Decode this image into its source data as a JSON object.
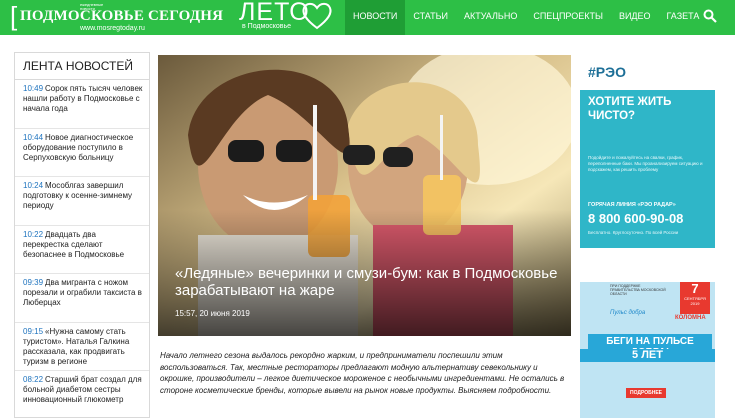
{
  "header": {
    "logo_bracket": "[",
    "logo_small": "ежедневные новости",
    "logo_title": "ПОДМОСКОВЬЕ СЕГОДНЯ",
    "logo_site": "www.mosregtoday.ru",
    "summer_big": "ЛЕТО",
    "summer_sub": "в Подмосковье",
    "nav": [
      "НОВОСТИ",
      "СТАТЬИ",
      "АКТУАЛЬНО",
      "СПЕЦПРОЕКТЫ",
      "ВИДЕО",
      "ГАЗЕТА"
    ],
    "active_nav": "НОВОСТИ",
    "brand_color": "#2dbf46"
  },
  "feed": {
    "title": "ЛЕНТА НОВОСТЕЙ",
    "items": [
      {
        "time": "10:49",
        "text": "Сорок пять тысяч человек нашли работу в Подмосковье с начала года"
      },
      {
        "time": "10:44",
        "text": "Новое диагностическое оборудование поступило в Серпуховскую больницу"
      },
      {
        "time": "10:24",
        "text": "Мособлгаз завершил подготовку к осенне-зимнему периоду"
      },
      {
        "time": "10:22",
        "text": "Двадцать два перекрестка сделают безопаснее в Подмосковье"
      },
      {
        "time": "09:39",
        "text": "Два мигранта с ножом порезали и ограбили таксиста в Люберцах"
      },
      {
        "time": "09:15",
        "text": "«Нужна самому стать туристом». Наталья Галкина рассказала, как продвигать туризм в регионе"
      },
      {
        "time": "08:22",
        "text": "Старший брат создал для больной диабетом сестры инновационный глюкометр"
      }
    ]
  },
  "hero": {
    "headline": "«Ледяные» вечеринки и смузи-бум: как в Подмосковье зарабатывают на жаре",
    "date": "15:57, 20 июня 2019"
  },
  "lead": "Начало летнего сезона выдалось рекордно жарким, и предприниматели поспешили этим воспользоваться. Так, местные рестораторы предлагают модную альтернативу севекольнику и окрошке, производители – легкое диетическое мороженое с необычными ингредиентами. Не остались в стороне косметические бренды, которые вывели на рынок новые продукты. Выясняем подробности.",
  "ad1": {
    "logo": "#РЭО",
    "slogan": "ХОТИТЕ ЖИТЬ ЧИСТО?",
    "bullets": "Подойдите и пожалуйтесь на свалки, график, переполненные баки. Мы проанализируем ситуацию и подскажем, как решить проблему",
    "hotline": "ГОРЯЧАЯ ЛИНИЯ «РЭО РАДАР»",
    "phone": "8 800 600-90-08",
    "free": "Бесплатно. Круглосуточно. По всей России"
  },
  "ad2": {
    "gov": "ПРИ ПОДДЕРЖКЕ ПРАВИТЕЛЬСТВА МОСКОВСКОЙ ОБЛАСТИ",
    "day": "7",
    "month": "СЕНТЯБРЯ 2019",
    "city": "КОЛОМНА",
    "brand": "Пульс добра",
    "run": "БЕГИ НА ПУЛЬСЕ ДОБРА!",
    "years": "5 ЛЕТ",
    "more": "ПОДРОБНЕЕ"
  }
}
